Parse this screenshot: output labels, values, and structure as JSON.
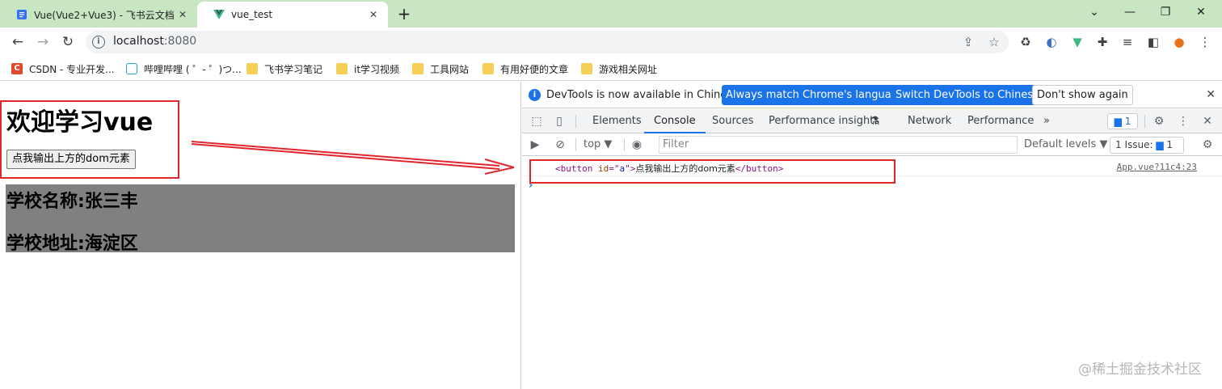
{
  "browser": {
    "tabs": [
      {
        "title": "Vue(Vue2+Vue3) - 飞书云文档",
        "close": "✕"
      },
      {
        "title": "vue_test",
        "close": "✕"
      }
    ],
    "new_tab": "+",
    "window_controls": {
      "minimize": "⌄",
      "restore": "—",
      "maximize": "❐",
      "close": "✕"
    },
    "nav": {
      "back": "←",
      "forward": "→",
      "reload": "↻"
    },
    "url_host": "localhost",
    "url_port": ":8080",
    "bookmarks": [
      {
        "label": "CSDN - 专业开发...",
        "icon": "csdn-icon"
      },
      {
        "label": "哔哩哔哩 ( ゜- ゜)つ...",
        "icon": "bilibili-icon"
      },
      {
        "label": "飞书学习笔记",
        "icon": "folder-icon"
      },
      {
        "label": "it学习视频",
        "icon": "folder-icon"
      },
      {
        "label": "工具网站",
        "icon": "folder-icon"
      },
      {
        "label": "有用好便的文章",
        "icon": "folder-icon"
      },
      {
        "label": "游戏相关网址",
        "icon": "folder-icon"
      }
    ]
  },
  "page": {
    "heading": "欢迎学习vue",
    "button_label": "点我输出上方的dom元素",
    "school_name": "学校名称:张三丰",
    "school_address": "学校地址:海淀区"
  },
  "devtools": {
    "info_text": "DevTools is now available in Chinese!",
    "btn_match": "Always match Chrome's language",
    "btn_switch": "Switch DevTools to Chinese",
    "btn_dismiss": "Don't show again",
    "tabs": [
      "Elements",
      "Console",
      "Sources",
      "Performance insights",
      "Network",
      "Performance"
    ],
    "more_tabs": "»",
    "message_count": "1",
    "context": "top ▼",
    "filter_placeholder": "Filter",
    "levels": "Default levels ▼",
    "issues_label": "1 Issue:",
    "issues_count": "1",
    "log": {
      "open_tag": "<button",
      "attr_name": " id",
      "attr_eq": "=\"",
      "attr_value": "a",
      "attr_close": "\">",
      "text": "点我输出上方的dom元素",
      "close_tag": "</button>"
    },
    "source_link": "App.vue?11c4:23",
    "prompt": "›"
  },
  "watermark": "@稀土掘金技术社区",
  "colors": {
    "annotation_red": "#e0262d",
    "accent_blue": "#1a73e8",
    "tab_strip": "#c9e6c2"
  }
}
